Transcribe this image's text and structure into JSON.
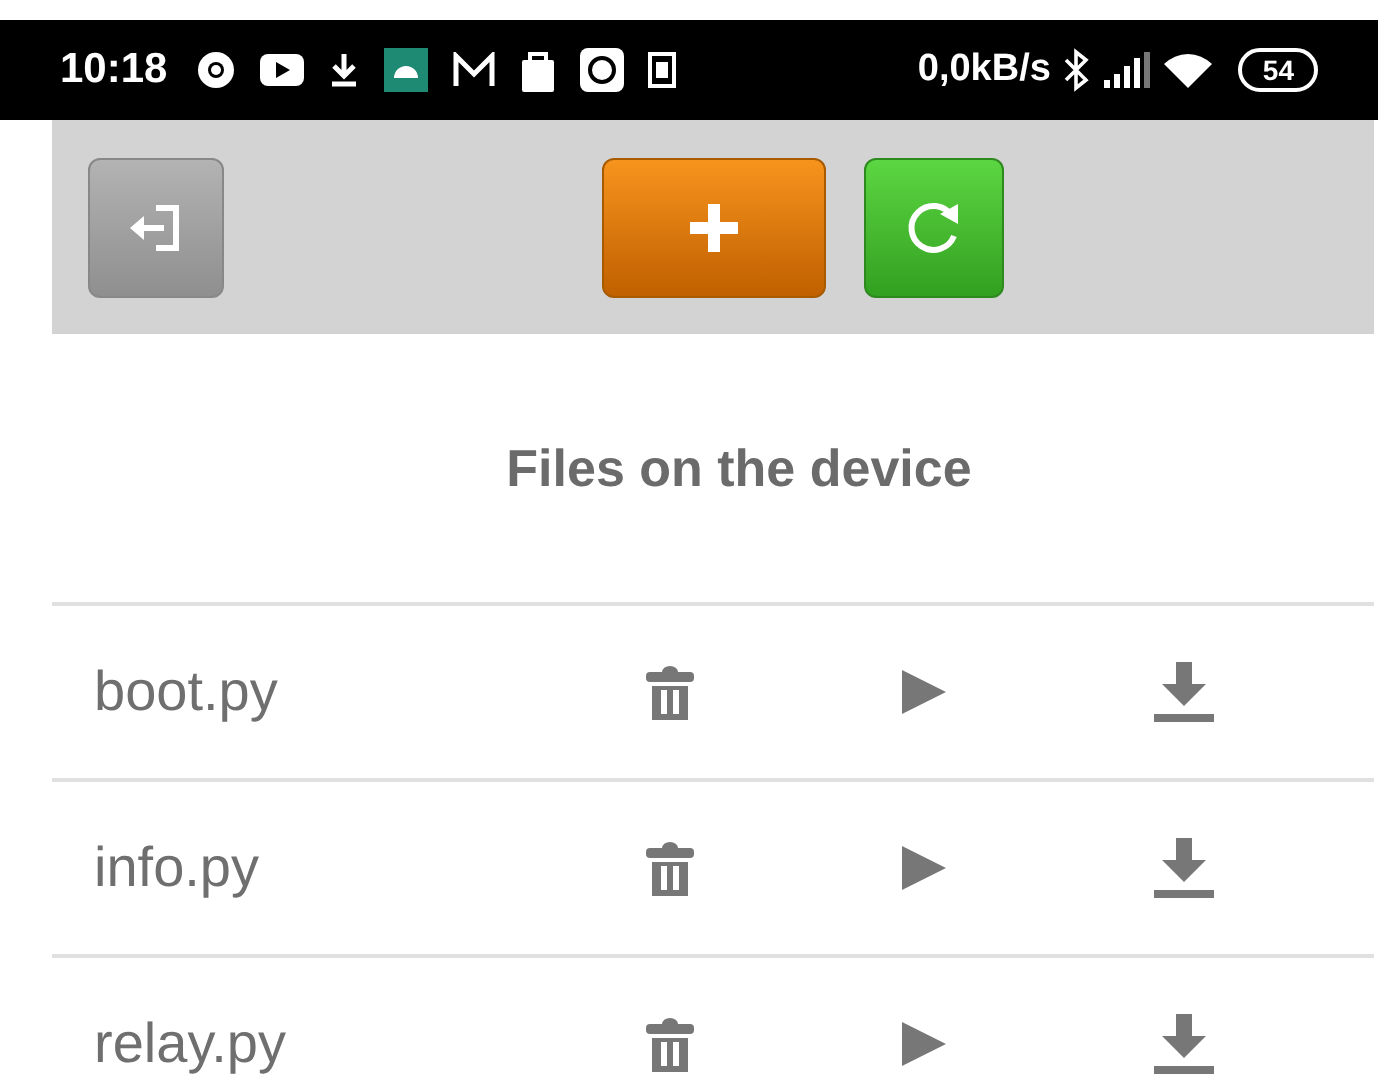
{
  "status_bar": {
    "time": "10:18",
    "speed": "0,0kB/s",
    "battery": "54"
  },
  "title": "Files on the device",
  "files": [
    {
      "name": "boot.py"
    },
    {
      "name": "info.py"
    },
    {
      "name": "relay.py"
    }
  ]
}
